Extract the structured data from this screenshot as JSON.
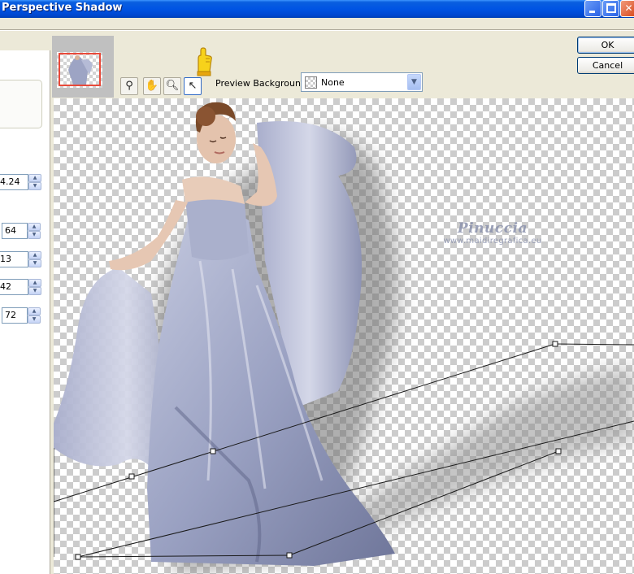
{
  "window": {
    "title": "Perspective Shadow"
  },
  "buttons": {
    "ok": "OK",
    "cancel": "Cancel"
  },
  "toolbar": {
    "tools": [
      {
        "name": "pan-zoom-icon"
      },
      {
        "name": "hand-icon"
      },
      {
        "name": "magnifier-icon"
      },
      {
        "name": "arrow-pointer-icon",
        "selected": true
      }
    ],
    "hint_icon": "pointing-hand-icon"
  },
  "preview_background": {
    "label": "Preview Background:",
    "value": "None"
  },
  "settings": {
    "fields": [
      {
        "value": "4.24"
      },
      {
        "value": "64"
      },
      {
        "value": "13"
      },
      {
        "value": "42"
      },
      {
        "value": "72"
      }
    ]
  },
  "watermark": {
    "line1": "Pinuccia",
    "line2": "www.maidiregrafica.eu"
  },
  "colors": {
    "accent": "#0054e3",
    "dress": "#9da4c4",
    "shadow": "#8a8a8a",
    "nav_frame": "#e84a3a"
  }
}
